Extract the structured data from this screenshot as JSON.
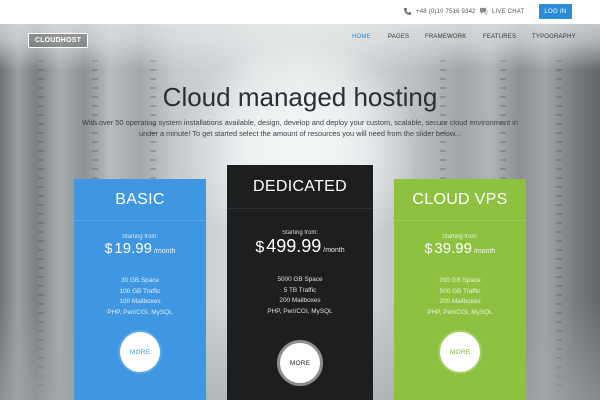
{
  "topbar": {
    "phone": "+48 (0)10 7516 9342",
    "phone_icon": "phone-icon",
    "chat": "LIVE CHAT",
    "chat_icon": "chat-bubble-icon",
    "login": "LOG IN"
  },
  "brand": {
    "logo": "CLOUDHOST"
  },
  "nav": {
    "items": [
      {
        "label": "HOME",
        "active": true
      },
      {
        "label": "PAGES",
        "active": false
      },
      {
        "label": "FRAMEWORK",
        "active": false
      },
      {
        "label": "FEATURES",
        "active": false
      },
      {
        "label": "TYPOGRAPHY",
        "active": false
      }
    ]
  },
  "hero": {
    "title": "Cloud managed hosting",
    "subtitle_line1": "With over 50 operating system installations available, design, develop and deploy your custom, scalable, secure cloud environment in",
    "subtitle_line2": "under a minute! To get started select the amount of resources you will need from the slider below..."
  },
  "plans": [
    {
      "name": "BASIC",
      "starting": "Starting from:",
      "currency": "$",
      "amount": "19.99",
      "period": "/month",
      "features": [
        "30 GB Space",
        "100 GB Traffic",
        "100 Mailboxes",
        "PHP, Perl/CGI, MySQL"
      ],
      "more": "MORE",
      "color": "#3e97e0"
    },
    {
      "name": "DEDICATED",
      "starting": "Starting from:",
      "currency": "$",
      "amount": "499.99",
      "period": "/month",
      "features": [
        "5000 GB Space",
        "5 TB Traffic",
        "200 Mailboxes",
        "PHP, Perl/CGI, MySQL"
      ],
      "more": "MORE",
      "color": "#1d1e20"
    },
    {
      "name": "CLOUD VPS",
      "starting": "Starting from:",
      "currency": "$",
      "amount": "39.99",
      "period": "/month",
      "features": [
        "200 GB Space",
        "500 GB Traffic",
        "200 Mailboxes",
        "PHP, Perl/CGI, MySQL"
      ],
      "more": "MORE",
      "color": "#8dc13f"
    }
  ]
}
